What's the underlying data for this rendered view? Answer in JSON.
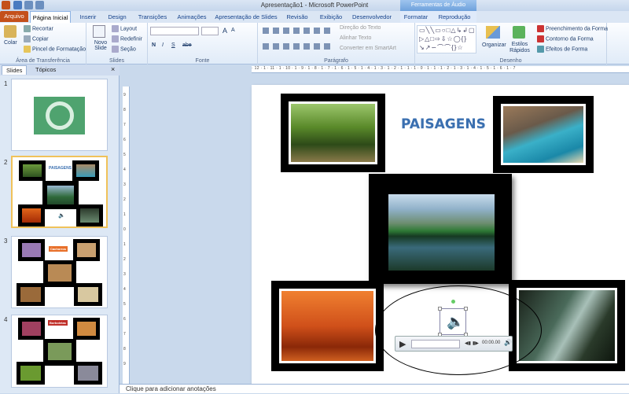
{
  "window": {
    "title": "Apresentação1 - Microsoft PowerPoint",
    "context_header": "Ferramentas de Áudio"
  },
  "tabs": {
    "file": "Arquivo",
    "items": [
      "Página Inicial",
      "Inserir",
      "Design",
      "Transições",
      "Animações",
      "Apresentação de Slides",
      "Revisão",
      "Exibição",
      "Desenvolvedor",
      "Formatar",
      "Reprodução"
    ],
    "active": "Página Inicial"
  },
  "ribbon": {
    "clipboard": {
      "label": "Área de Transferência",
      "paste": "Colar",
      "cut": "Recortar",
      "copy": "Copiar",
      "format_painter": "Pincel de Formatação"
    },
    "slides": {
      "label": "Slides",
      "new_slide": "Novo Slide",
      "layout": "Layout",
      "reset": "Redefinir",
      "section": "Seção"
    },
    "font": {
      "label": "Fonte",
      "bold": "N",
      "italic": "I",
      "underline": "S",
      "strike": "abe",
      "grow": "A",
      "shrink": "A"
    },
    "paragraph": {
      "label": "Parágrafo",
      "text_direction": "Direção do Texto",
      "align_text": "Alinhar Texto",
      "smartart": "Converter em SmartArt"
    },
    "drawing": {
      "label": "Desenho",
      "arrange": "Organizar",
      "quick_styles": "Estilos Rápidos",
      "fill": "Preenchimento da Forma",
      "outline": "Contorno da Forma",
      "effects": "Efeitos de Forma"
    }
  },
  "pane": {
    "tabs": [
      "Slides",
      "Tópicos"
    ],
    "slides": [
      {
        "num": "1"
      },
      {
        "num": "2",
        "title": "PAISAGENS"
      },
      {
        "num": "3",
        "title": "Cachorros"
      },
      {
        "num": "4",
        "title": "Borboletas"
      }
    ]
  },
  "ruler": {
    "h_ticks": "· 12 · 1 · 11 · 1 · 10 · 1 · 9 · 1 · 8 · 1 · 7 · 1 · 6 · 1 · 5 · 1 · 4 · 1 · 3 · 1 · 2 · 1 · 1 · 1 · 0 · 1 · 1 · 1 · 2 · 1 · 3 · 1 · 4 · 1 · 5 · 1 · 6 · 1 · 7",
    "v_ticks": [
      "9",
      "8",
      "7",
      "6",
      "5",
      "4",
      "3",
      "2",
      "1",
      "0",
      "1",
      "2",
      "3",
      "4",
      "5",
      "6",
      "7",
      "8",
      "9"
    ]
  },
  "slide": {
    "title": "PAISAGENS",
    "audio": {
      "time": "00:00.00"
    }
  },
  "notes": {
    "placeholder": "Clique para adicionar anotações"
  },
  "colors": {
    "accent": "#2b579a",
    "file_tab": "#c4501b",
    "title_text": "#3a6fb0"
  }
}
